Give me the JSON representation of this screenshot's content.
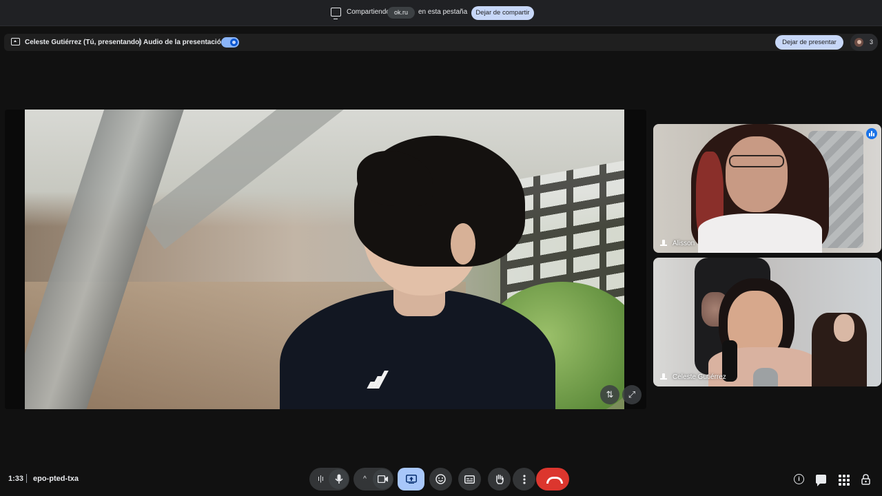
{
  "share_bar": {
    "sharing_label": "Compartiendo",
    "site": "ok.ru",
    "tab_label": "en esta pestaña",
    "stop_sharing": "Dejar de compartir"
  },
  "present_bar": {
    "presenter": "Celeste Gutiérrez (Tú, presentando)",
    "audio_label": "Audio de la presentación",
    "audio_enabled": true,
    "stop_presenting": "Dejar de presentar",
    "participant_count": "3"
  },
  "participants": [
    {
      "name": "Alisson",
      "speaking": true
    },
    {
      "name": "Celeste Gutiérrez",
      "speaking": false
    }
  ],
  "footer": {
    "time": "1:33",
    "meeting_code": "epo-pted-txa"
  },
  "controls": {
    "present_icon": "present-screen-icon",
    "mic_icon": "microphone-icon",
    "camera_icon": "camera-icon",
    "emoji_icon": "emoji-icon",
    "captions_icon": "captions-icon",
    "hand_icon": "raise-hand-icon",
    "more_icon": "more-options-icon",
    "end_icon": "end-call-icon",
    "accent": "#a8c7fa",
    "end_color": "#dc362e"
  }
}
